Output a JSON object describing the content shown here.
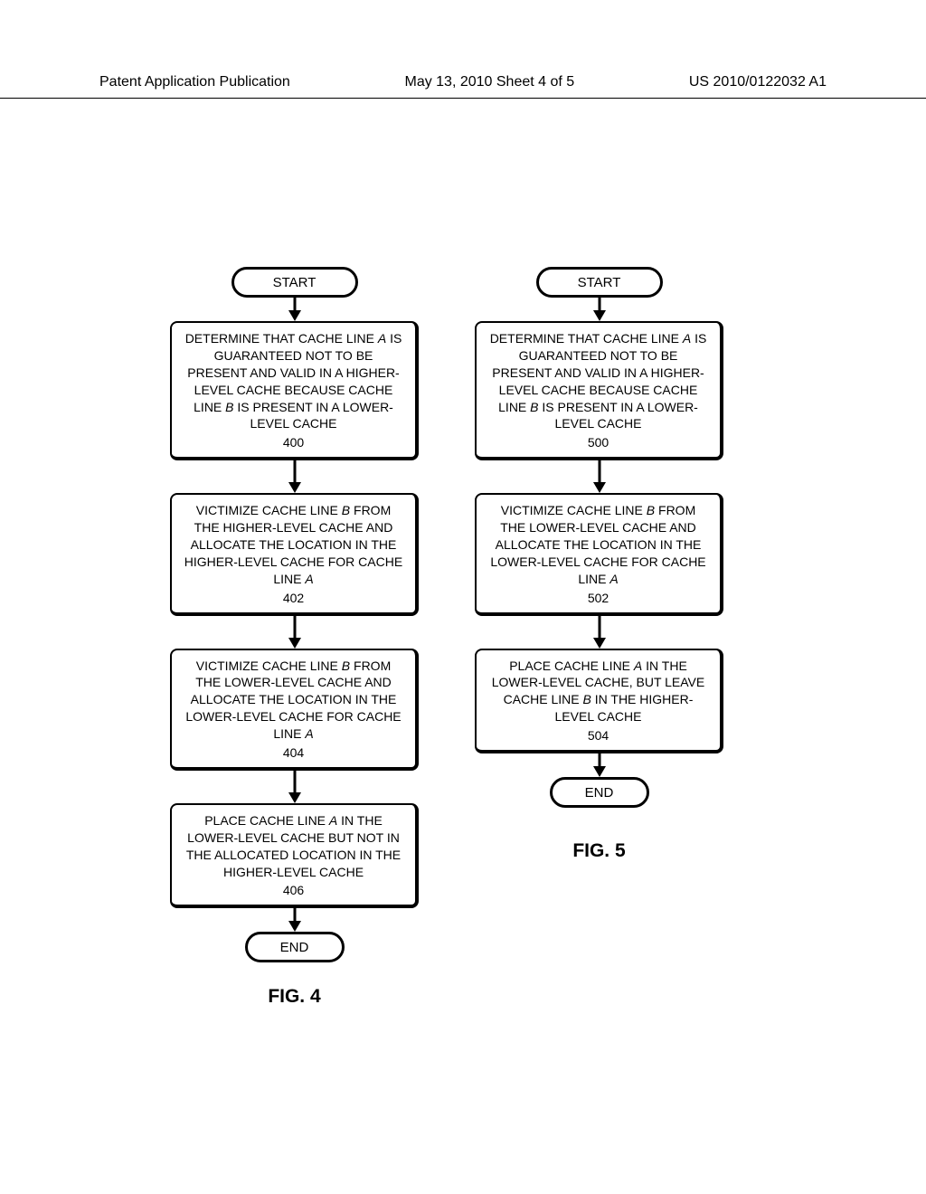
{
  "header": {
    "left": "Patent Application Publication",
    "center": "May 13, 2010  Sheet 4 of 5",
    "right": "US 2010/0122032 A1"
  },
  "common": {
    "start": "START",
    "end": "END"
  },
  "fig4": {
    "label": "FIG. 4",
    "box400": {
      "l1a": "DETERMINE THAT CACHE LINE ",
      "l1b": "A",
      "l1c": " IS",
      "l2": "GUARANTEED NOT TO BE",
      "l3": "PRESENT AND VALID IN A HIGHER-",
      "l4a": "LEVEL CACHE BECAUSE CACHE",
      "l5a": "LINE ",
      "l5b": "B",
      "l5c": " IS PRESENT IN A LOWER-",
      "l6": "LEVEL CACHE",
      "num": "400"
    },
    "box402": {
      "l1a": "VICTIMIZE CACHE LINE ",
      "l1b": "B",
      "l1c": " FROM",
      "l2": "THE HIGHER-LEVEL CACHE AND",
      "l3": "ALLOCATE THE LOCATION IN THE",
      "l4": "HIGHER-LEVEL CACHE FOR CACHE",
      "l5a": "LINE ",
      "l5b": "A",
      "num": "402"
    },
    "box404": {
      "l1a": "VICTIMIZE CACHE LINE ",
      "l1b": "B",
      "l1c": " FROM",
      "l2": "THE LOWER-LEVEL CACHE AND",
      "l3": "ALLOCATE THE LOCATION IN THE",
      "l4": "LOWER-LEVEL CACHE FOR CACHE",
      "l5a": "LINE ",
      "l5b": "A",
      "num": "404"
    },
    "box406": {
      "l1a": "PLACE CACHE LINE ",
      "l1b": "A",
      "l1c": " IN THE",
      "l2": "LOWER-LEVEL CACHE BUT NOT IN",
      "l3": "THE ALLOCATED LOCATION IN THE",
      "l4": "HIGHER-LEVEL CACHE",
      "num": "406"
    }
  },
  "fig5": {
    "label": "FIG. 5",
    "box500": {
      "l1a": "DETERMINE THAT CACHE LINE ",
      "l1b": "A",
      "l1c": " IS",
      "l2": "GUARANTEED NOT TO BE",
      "l3": "PRESENT AND VALID IN A HIGHER-",
      "l4a": "LEVEL CACHE BECAUSE CACHE",
      "l5a": "LINE ",
      "l5b": "B",
      "l5c": " IS PRESENT IN A LOWER-",
      "l6": "LEVEL CACHE",
      "num": "500"
    },
    "box502": {
      "l1a": "VICTIMIZE CACHE LINE ",
      "l1b": "B",
      "l1c": " FROM",
      "l2": "THE LOWER-LEVEL CACHE AND",
      "l3": "ALLOCATE THE LOCATION IN THE",
      "l4": "LOWER-LEVEL CACHE FOR CACHE",
      "l5a": "LINE ",
      "l5b": "A",
      "num": "502"
    },
    "box504": {
      "l1a": "PLACE CACHE LINE ",
      "l1b": "A",
      "l1c": " IN THE",
      "l2": "LOWER-LEVEL CACHE, BUT LEAVE",
      "l3a": "CACHE LINE ",
      "l3b": "B",
      "l3c": " IN THE HIGHER-",
      "l4": "LEVEL CACHE",
      "num": "504"
    }
  }
}
